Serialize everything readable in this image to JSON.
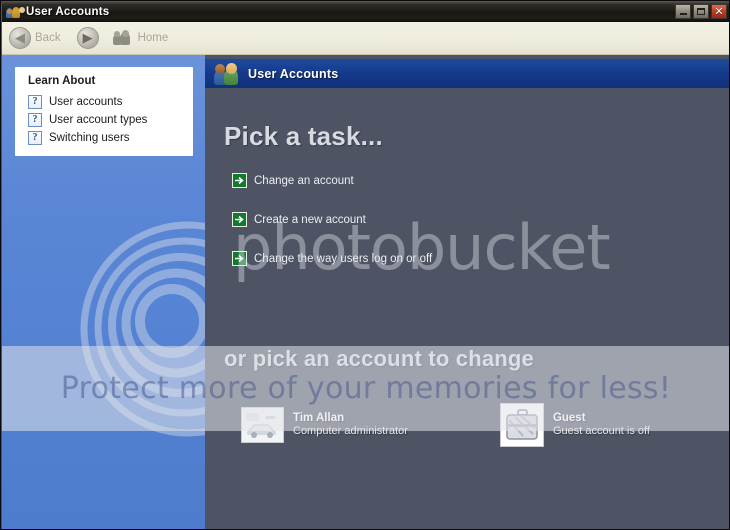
{
  "window": {
    "title": "User Accounts",
    "title_icon": "user-accounts-icon",
    "buttons": {
      "minimize": "minimize-button",
      "maximize": "maximize-button",
      "close_glyph": "✕"
    }
  },
  "toolbar": {
    "back_label": "Back",
    "back_glyph": "◀",
    "forward_glyph": "▶",
    "home_label": "Home"
  },
  "sidebar": {
    "panel_title": "Learn About",
    "items": [
      {
        "label": "User accounts",
        "icon": "help-question-icon",
        "glyph": "?"
      },
      {
        "label": "User account types",
        "icon": "help-question-icon",
        "glyph": "?"
      },
      {
        "label": "Switching users",
        "icon": "help-question-icon",
        "glyph": "?"
      }
    ]
  },
  "content": {
    "header_title": "User Accounts",
    "heading_tasks": "Pick a task...",
    "tasks": [
      {
        "label": "Change an account",
        "icon": "green-arrow-icon"
      },
      {
        "label": "Create a new account",
        "icon": "green-arrow-icon"
      },
      {
        "label": "Change the way users log on or off",
        "icon": "green-arrow-icon"
      }
    ],
    "heading_accounts": "or pick an account to change",
    "accounts": [
      {
        "name": "Tim Allan",
        "description": "Computer administrator",
        "picture": "car-avatar-icon"
      },
      {
        "name": "Guest",
        "description": "Guest account is off",
        "picture": "suitcase-avatar-icon"
      }
    ]
  },
  "watermark": {
    "brand": "photobucket",
    "tagline": "Protect more of your memories for less!"
  },
  "colors": {
    "sidebar_blue": "#5a86d5",
    "content_bg": "#4f5464",
    "header_blue": "#15398a",
    "arrow_green": "#117a2c",
    "toolbar_bg": "#eeecdd",
    "titlebar_dark": "#191713"
  }
}
